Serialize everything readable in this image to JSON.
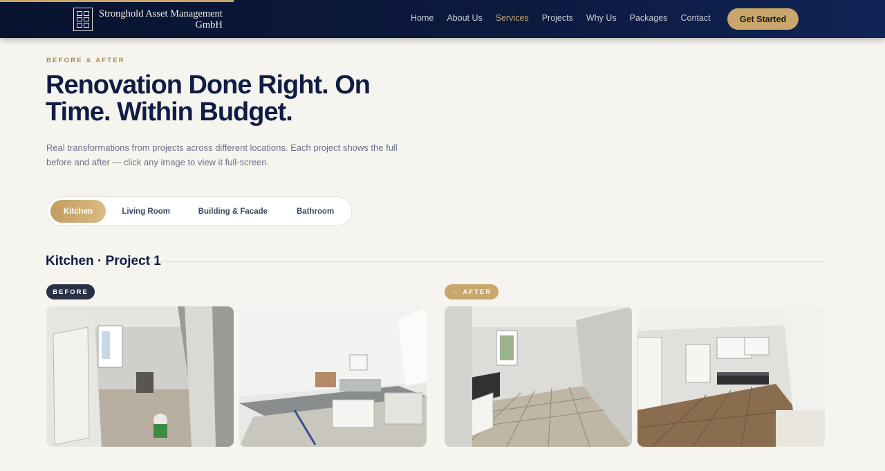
{
  "header": {
    "brand_line1": "Stronghold Asset Management",
    "brand_line2": "GmbH",
    "nav": [
      {
        "label": "Home"
      },
      {
        "label": "About Us"
      },
      {
        "label": "Services",
        "active": true
      },
      {
        "label": "Projects"
      },
      {
        "label": "Why Us"
      },
      {
        "label": "Packages"
      },
      {
        "label": "Contact"
      }
    ],
    "cta_label": "Get Started",
    "accent_color": "#c9a66b"
  },
  "hero": {
    "eyebrow": "BEFORE & AFTER",
    "headline": "Renovation Done Right. On Time. Within Budget.",
    "lede": "Real transformations from projects across different locations. Each project shows the full before and after — click any image to view it full-screen."
  },
  "tabs": [
    {
      "label": "Kitchen",
      "active": true
    },
    {
      "label": "Living Room"
    },
    {
      "label": "Building & Facade"
    },
    {
      "label": "Bathroom"
    }
  ],
  "project": {
    "title": "Kitchen · Project 1",
    "before_label": "BEFORE",
    "after_label": "AFTER",
    "after_icon": "arrow-right-icon"
  }
}
